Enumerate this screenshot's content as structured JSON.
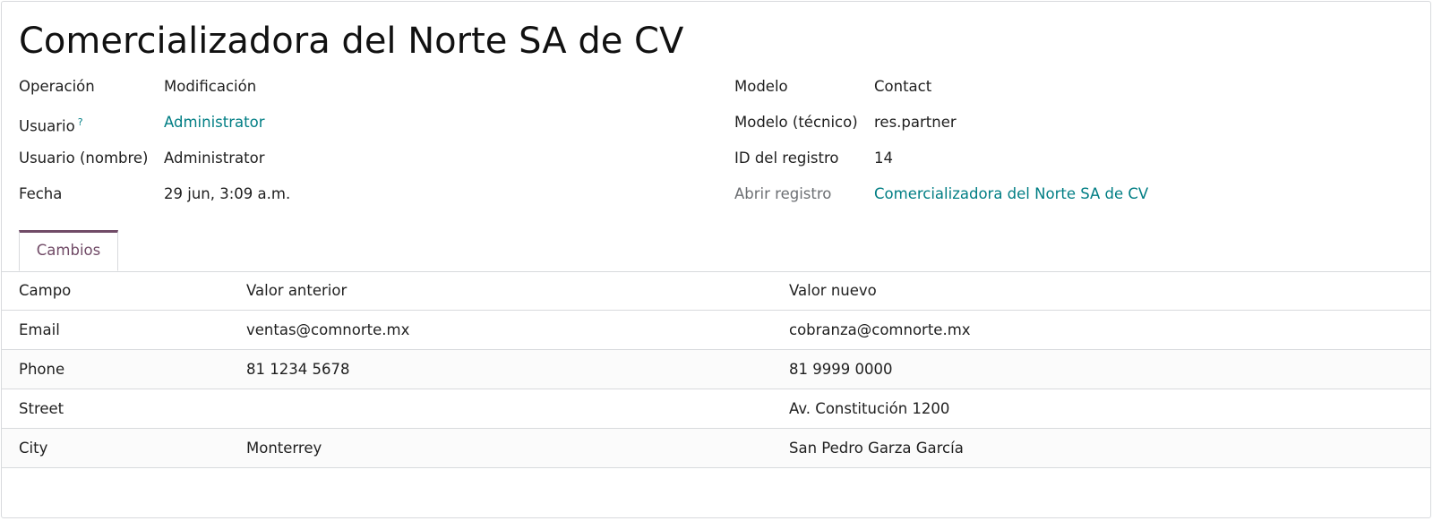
{
  "record": {
    "title": "Comercializadora del Norte SA de CV"
  },
  "left_fields": [
    {
      "label": "Operación",
      "value": "Modificación"
    },
    {
      "label": "Usuario",
      "help": "?",
      "value": "Administrator"
    },
    {
      "label": "Usuario (nombre)",
      "value": "Administrator"
    },
    {
      "label": "Fecha",
      "value": "29 jun, 3:09 a.m."
    }
  ],
  "right_fields": [
    {
      "label": "Modelo",
      "value": "Contact"
    },
    {
      "label": "Modelo (técnico)",
      "value": "res.partner"
    },
    {
      "label": "ID del registro",
      "value": "14"
    },
    {
      "label": "Abrir registro",
      "value": "Comercializadora del Norte SA de CV"
    }
  ],
  "tabs": [
    {
      "label": "Cambios",
      "active": true
    }
  ],
  "changes": {
    "headers": [
      "Campo",
      "Valor anterior",
      "Valor nuevo"
    ],
    "rows": [
      [
        "Email",
        "ventas@comnorte.mx",
        "cobranza@comnorte.mx"
      ],
      [
        "Phone",
        "81 1234 5678",
        "81 9999 0000"
      ],
      [
        "Street",
        "",
        "Av. Constitución 1200"
      ],
      [
        "City",
        "Monterrey",
        "San Pedro Garza García"
      ]
    ]
  },
  "colors": {
    "link": "#017e84",
    "tab_accent": "#714b67",
    "border": "#d8dadd"
  }
}
